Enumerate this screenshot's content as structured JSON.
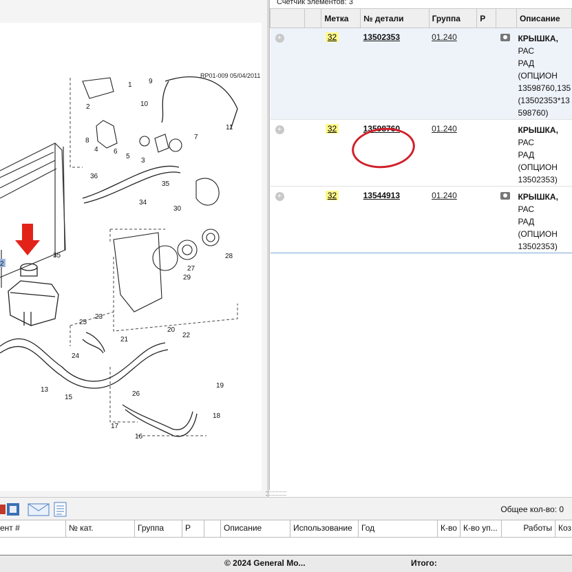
{
  "diagram": {
    "ref": "RP01-009 05/04/2011",
    "callouts": [
      "1",
      "2",
      "3",
      "4",
      "5",
      "6",
      "7",
      "8",
      "9",
      "10",
      "11",
      "13",
      "15",
      "16",
      "17",
      "18",
      "19",
      "20",
      "21",
      "22",
      "23",
      "24",
      "25",
      "26",
      "27",
      "28",
      "29",
      "30",
      "34",
      "35",
      "35",
      "36"
    ],
    "selected_callout": "2"
  },
  "parts_list": {
    "counter": "Счетчик элементов: 3",
    "columns": [
      "Метка",
      "№ детали",
      "Группа",
      "P",
      "Описание"
    ],
    "rows": [
      {
        "tag": "32",
        "part_no": "13502353",
        "group": "01.240",
        "p": "",
        "desc_bold": "КРЫШКА,",
        "desc_rest": " РАС",
        "desc_lines": [
          "РАД (ОПЦИОН",
          "13598760,135",
          "(13502353*13",
          "598760)"
        ],
        "has_photo": true
      },
      {
        "tag": "32",
        "part_no": "13598760",
        "group": "01.240",
        "p": "",
        "desc_bold": "КРЫШКА,",
        "desc_rest": " РАС",
        "desc_lines": [
          "РАД (ОПЦИОН",
          "13502353)"
        ],
        "has_photo": false
      },
      {
        "tag": "32",
        "part_no": "13544913",
        "group": "01.240",
        "p": "",
        "desc_bold": "КРЫШКА,",
        "desc_rest": " РАС",
        "desc_lines": [
          "РАД (ОПЦИОН",
          "13502353)"
        ],
        "has_photo": true
      }
    ]
  },
  "toolbar": {
    "total_qty": "Общее кол-во: 0",
    "icons": [
      "print-icon",
      "copy-icon",
      "email-icon",
      "document-icon"
    ]
  },
  "cart": {
    "columns": [
      "ент #",
      "№ кат.",
      "Группа",
      "P",
      "Описание",
      "Использование",
      "Год",
      "К-во",
      "К-во уп...",
      "Работы",
      "Коз"
    ]
  },
  "footer": {
    "copyright": "© 2024 General Mo...",
    "total_label": "Итого:"
  },
  "colors": {
    "highlight": "#d0202a",
    "tag_bg": "#fff98a",
    "selected_row_border": "#7aa7d4"
  }
}
